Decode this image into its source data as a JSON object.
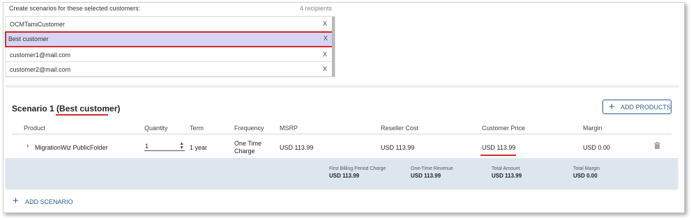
{
  "recipients": {
    "title": "Create scenarios for these selected customers:",
    "count": "4 recipients",
    "remove_symbol": "X",
    "items": [
      {
        "name": "OCMTamiCustomer"
      },
      {
        "name": "Best customer"
      },
      {
        "name": "customer1@mail.com"
      },
      {
        "name": "customer2@mail.com"
      }
    ]
  },
  "scenario": {
    "title_prefix": "Scenario 1 (",
    "customer": "Best customer",
    "title_suffix": ")",
    "add_products_label": "ADD PRODUCTS",
    "columns": [
      "Product",
      "Quantity",
      "Term",
      "Frequency",
      "MSRP",
      "Reseller Cost",
      "Customer Price",
      "Margin"
    ],
    "row": {
      "product": "MigrationWiz PublicFolder",
      "quantity": "1",
      "term": "1 year",
      "frequency_line1": "One Time",
      "frequency_line2": "Charge",
      "msrp": "USD 113.99",
      "reseller_cost": "USD 113.99",
      "customer_price": "USD 113.99",
      "margin": "USD 0.00"
    },
    "totals": [
      {
        "label": "First Billing Period Charge",
        "value": "USD 113.99"
      },
      {
        "label": "One-Time Revenue",
        "value": "USD 113.99"
      },
      {
        "label": "Total Amount",
        "value": "USD 113.99"
      },
      {
        "label": "Total Margin",
        "value": "USD 0.00"
      }
    ]
  },
  "footer": {
    "add_scenario_label": "ADD SCENARIO"
  },
  "icons": {
    "plus": "+",
    "chevron": "›",
    "spinner": "▲▼"
  },
  "colors": {
    "accent": "#2d5d8f",
    "highlight_border": "#d12c2c",
    "selected_bg": "#d8d4f3",
    "totals_bg": "#dde6ef"
  }
}
